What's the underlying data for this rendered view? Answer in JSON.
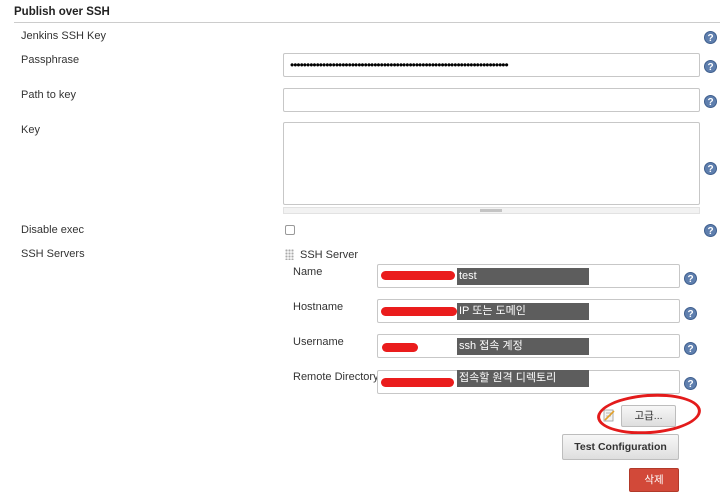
{
  "section": {
    "title": "Publish over SSH"
  },
  "fields": {
    "jenkins_ssh_key_label": "Jenkins SSH Key",
    "passphrase_label": "Passphrase",
    "passphrase_value": "••••••••••••••••••••••••••••••••••••••••••••••••••••••••••••••••••••",
    "path_to_key_label": "Path to key",
    "path_to_key_value": "",
    "key_label": "Key",
    "disable_exec_label": "Disable exec",
    "ssh_servers_label": "SSH Servers"
  },
  "ssh_server": {
    "title": "SSH Server",
    "name_label": "Name",
    "name_annotation": "test",
    "hostname_label": "Hostname",
    "hostname_annotation": "IP 또는 도메인",
    "username_label": "Username",
    "username_annotation": "ssh 접속 계정",
    "remote_directory_label": "Remote Directory",
    "remote_directory_annotation": "접속할 원격 디렉토리"
  },
  "buttons": {
    "advanced": "고급...",
    "test_configuration": "Test Configuration",
    "delete": "삭제"
  },
  "help_glyph": "?",
  "colors": {
    "annotation_highlight": "#ea1c1c",
    "delete_button": "#d24939",
    "help_icon": "#5f7fae"
  }
}
